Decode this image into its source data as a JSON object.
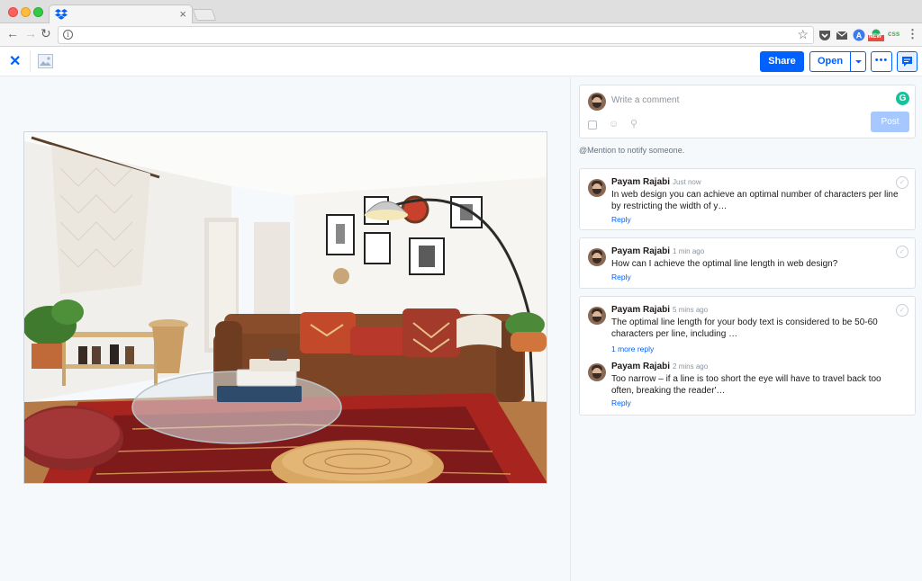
{
  "browser": {
    "tab_close": "×",
    "icons": [
      "dropbox-favicon",
      "back-arrow-icon",
      "forward-arrow-icon",
      "reload-icon",
      "info-icon",
      "star-icon",
      "pocket-icon",
      "mail-icon",
      "extension-a-icon",
      "new-badge-icon",
      "css-icon",
      "menu-dots-icon"
    ],
    "ext_css": "css",
    "ext_new": "NEW"
  },
  "toolbar": {
    "share_label": "Share",
    "open_label": "Open",
    "more_label": "•••"
  },
  "composer": {
    "placeholder": "Write a comment",
    "post_label": "Post",
    "grammarly": "G"
  },
  "mention_hint": "@Mention to notify someone.",
  "comments": [
    {
      "author": "Payam Rajabi",
      "time": "Just now",
      "text": "In web design you can achieve an optimal number of characters per line by restricting the width of y…",
      "reply": "Reply"
    },
    {
      "author": "Payam Rajabi",
      "time": "1 min ago",
      "text": "How can I achieve the optimal line length in web design?",
      "reply": "Reply"
    },
    {
      "author": "Payam Rajabi",
      "time": "5 mins ago",
      "text": "The optimal line length for your body text is considered to be 50-60 characters per line, including …",
      "more_reply": "1 more reply",
      "sub": {
        "author": "Payam Rajabi",
        "time": "2 mins ago",
        "text": "Too narrow – if a line is too short the eye will have to travel back too often, breaking the reader'…",
        "reply": "Reply"
      }
    }
  ],
  "colors": {
    "accent": "#0061fe",
    "grammarly": "#15c39a",
    "post_disabled": "#a6c8ff"
  }
}
